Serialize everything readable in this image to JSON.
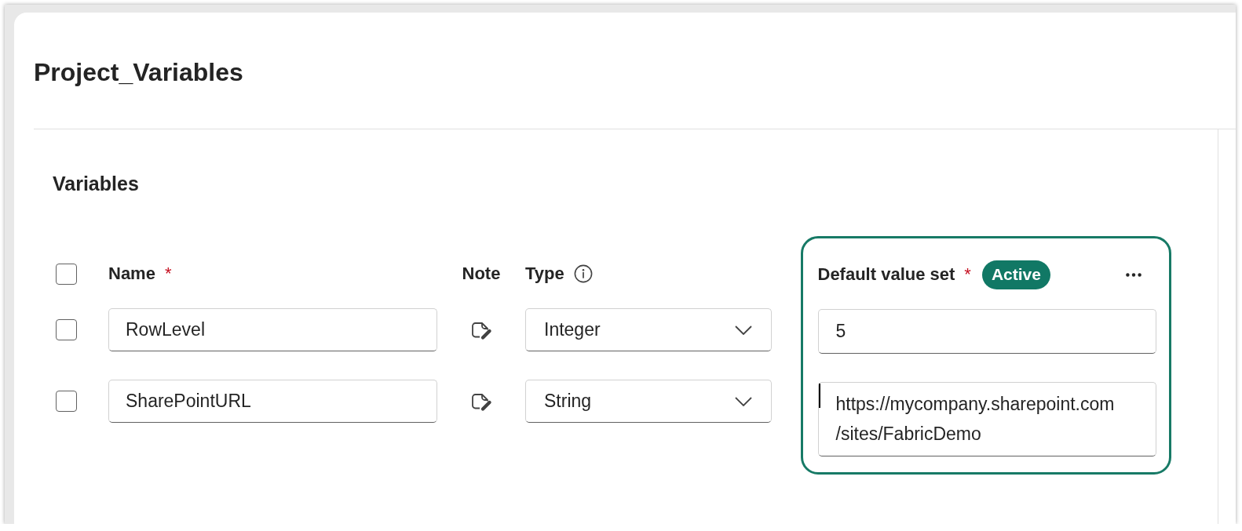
{
  "page": {
    "title": "Project_Variables"
  },
  "section": {
    "title": "Variables"
  },
  "table": {
    "select_all": {
      "checked": false
    },
    "columns": {
      "name": {
        "label": "Name",
        "required_mark": "*"
      },
      "note": {
        "label": "Note"
      },
      "type": {
        "label": "Type",
        "info": true
      }
    },
    "rows": [
      {
        "checked": false,
        "name": "RowLevel",
        "type": "Integer"
      },
      {
        "checked": false,
        "name": "SharePointURL",
        "type": "String"
      }
    ]
  },
  "value_set": {
    "label": "Default value set",
    "required_mark": "*",
    "status": "Active",
    "highlighted": true,
    "values": [
      {
        "lines": [
          "5"
        ],
        "focused": false
      },
      {
        "lines": [
          "https://mycompany.sharepoint.com",
          "/sites/FabricDemo"
        ],
        "focused": true
      }
    ]
  }
}
